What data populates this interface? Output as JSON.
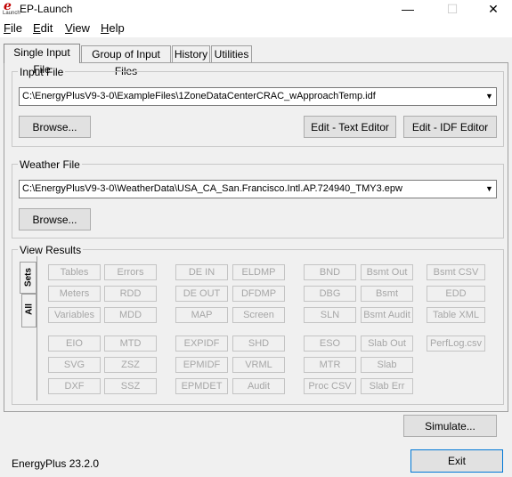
{
  "window": {
    "title": "EP-Launch",
    "icon_name": "ep-launch-app-icon",
    "controls": {
      "minimize": "—",
      "maximize": "☐",
      "close": "✕"
    }
  },
  "menu": {
    "items": [
      {
        "label": "File",
        "accel": "F",
        "rest": "ile"
      },
      {
        "label": "Edit",
        "accel": "E",
        "rest": "dit"
      },
      {
        "label": "View",
        "accel": "V",
        "rest": "iew"
      },
      {
        "label": "Help",
        "accel": "H",
        "rest": "elp"
      }
    ]
  },
  "tabs": {
    "single": "Single Input File",
    "group": "Group of Input Files",
    "history": "History",
    "utilities": "Utilities",
    "selected": "Single Input File"
  },
  "input_file": {
    "title": "Input File",
    "path": "C:\\EnergyPlusV9-3-0\\ExampleFiles\\1ZoneDataCenterCRAC_wApproachTemp.idf",
    "browse": "Browse...",
    "edit_text": "Edit - Text Editor",
    "edit_idf": "Edit - IDF Editor"
  },
  "weather_file": {
    "title": "Weather File",
    "path": "C:\\EnergyPlusV9-3-0\\WeatherData\\USA_CA_San.Francisco.Intl.AP.724940_TMY3.epw",
    "browse": "Browse..."
  },
  "view_results": {
    "title": "View Results",
    "side_tabs": {
      "sets": "Sets",
      "all": "All"
    },
    "buttons": {
      "tables": "Tables",
      "errors": "Errors",
      "dein": "DE IN",
      "eldmp": "ELDMP",
      "bnd": "BND",
      "bsmt_out": "Bsmt Out",
      "bsmt_csv": "Bsmt CSV",
      "meters": "Meters",
      "rdd": "RDD",
      "deout": "DE OUT",
      "dfdmp": "DFDMP",
      "dbg": "DBG",
      "bsmt": "Bsmt",
      "edd": "EDD",
      "variables": "Variables",
      "mdd": "MDD",
      "map": "MAP",
      "screen": "Screen",
      "sln": "SLN",
      "bsmt_audit": "Bsmt Audit",
      "table_xml": "Table XML",
      "eio": "EIO",
      "mtd": "MTD",
      "expidf": "EXPIDF",
      "shd": "SHD",
      "eso": "ESO",
      "slab_out": "Slab Out",
      "perflog": "PerfLog.csv",
      "svg": "SVG",
      "zsz": "ZSZ",
      "epmidf": "EPMIDF",
      "vrml": "VRML",
      "mtr": "MTR",
      "slab": "Slab",
      "dxf": "DXF",
      "ssz": "SSZ",
      "epmdet": "EPMDET",
      "audit": "Audit",
      "proc_csv": "Proc CSV",
      "slab_err": "Slab Err"
    }
  },
  "simulate": "Simulate...",
  "exit": "Exit",
  "version": "EnergyPlus 23.2.0"
}
